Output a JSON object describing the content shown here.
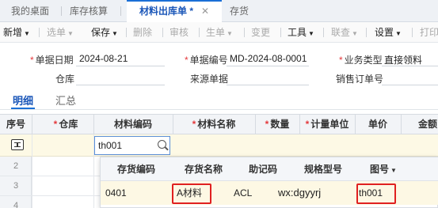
{
  "tabs": [
    {
      "label": "我的桌面"
    },
    {
      "label": "库存核算"
    },
    {
      "label": "材料出库单 *"
    },
    {
      "label": "存货"
    }
  ],
  "toolbar": {
    "add": "新增",
    "select": "选单",
    "save": "保存",
    "delete": "删除",
    "audit": "审核",
    "generate": "生单",
    "change": "变更",
    "tools": "工具",
    "query": "联查",
    "settings": "设置",
    "print": "打印"
  },
  "form": {
    "doc_date_label": "单据日期",
    "doc_date_value": "2024-08-21",
    "doc_no_label": "单据编号",
    "doc_no_value": "MD-2024-08-0001",
    "biz_type_label": "业务类型",
    "biz_type_value": "直接领料",
    "warehouse_label": "仓库",
    "source_label": "来源单据",
    "sales_order_label": "销售订单号"
  },
  "subtabs": {
    "detail": "明细",
    "summary": "汇总"
  },
  "grid": {
    "headers": {
      "seq": "序号",
      "warehouse": "仓库",
      "code": "材料编码",
      "name": "材料名称",
      "qty": "数量",
      "unit": "计量单位",
      "price": "单价",
      "amount": "金额"
    },
    "row_numbers": [
      "2",
      "3",
      "4"
    ],
    "code_input_value": "th001"
  },
  "lookup": {
    "headers": {
      "code": "存货编码",
      "name": "存货名称",
      "mnemonic": "助记码",
      "spec": "规格型号",
      "drawing": "图号"
    },
    "row": {
      "code": "0401",
      "name": "A材料",
      "mnemonic": "ACL",
      "spec": "wx:dgyyrj",
      "drawing": "th001"
    }
  },
  "colors": {
    "accent": "#1a6fd6",
    "required": "#e4393c",
    "highlight": "#e02020",
    "row_selected": "#fdf9e5"
  }
}
